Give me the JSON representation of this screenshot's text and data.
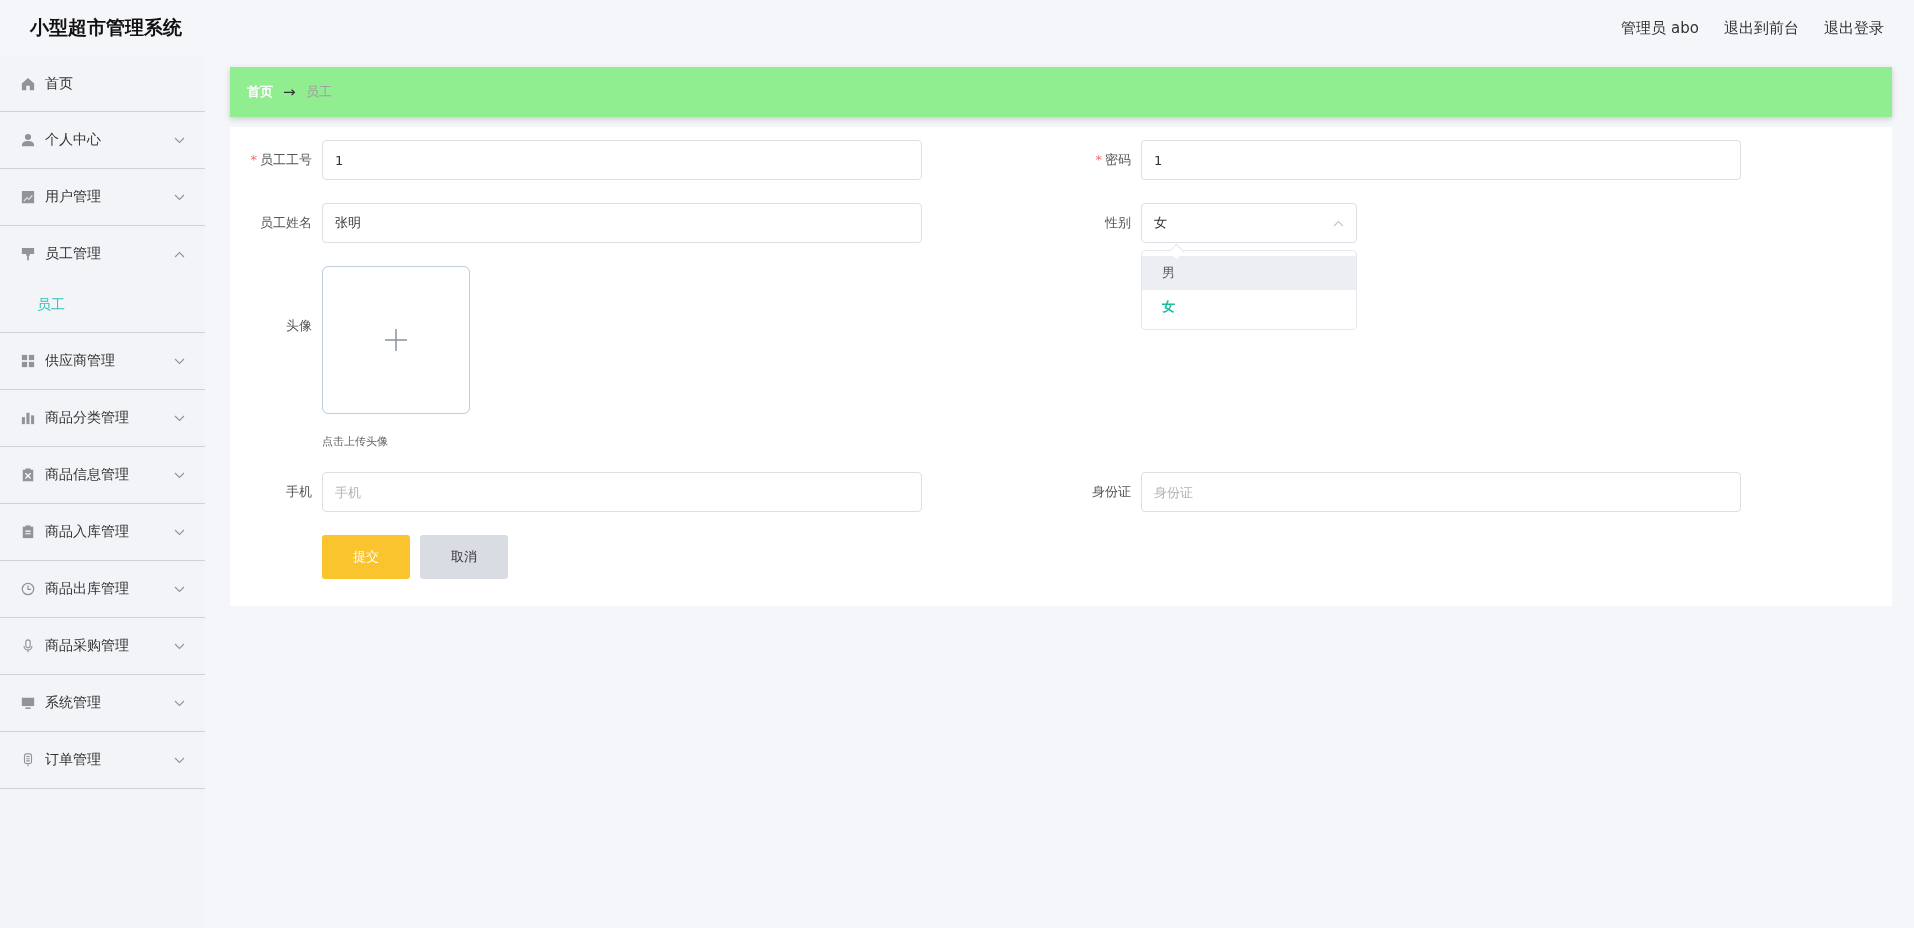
{
  "header": {
    "title": "小型超市管理系统",
    "links": [
      {
        "label": "管理员 abo"
      },
      {
        "label": "退出到前台"
      },
      {
        "label": "退出登录"
      }
    ]
  },
  "sidebar": {
    "items": [
      {
        "label": "首页",
        "kind": "link"
      },
      {
        "label": "个人中心",
        "kind": "group",
        "expanded": false
      },
      {
        "label": "用户管理",
        "kind": "group",
        "expanded": false
      },
      {
        "label": "员工管理",
        "kind": "group",
        "expanded": true,
        "children": [
          {
            "label": "员工",
            "selected": true
          }
        ]
      },
      {
        "label": "供应商管理",
        "kind": "group",
        "expanded": false
      },
      {
        "label": "商品分类管理",
        "kind": "group",
        "expanded": false
      },
      {
        "label": "商品信息管理",
        "kind": "group",
        "expanded": false
      },
      {
        "label": "商品入库管理",
        "kind": "group",
        "expanded": false
      },
      {
        "label": "商品出库管理",
        "kind": "group",
        "expanded": false
      },
      {
        "label": "商品采购管理",
        "kind": "group",
        "expanded": false
      },
      {
        "label": "系统管理",
        "kind": "group",
        "expanded": false
      },
      {
        "label": "订单管理",
        "kind": "group",
        "expanded": false
      }
    ]
  },
  "breadcrumb": {
    "items": [
      {
        "label": "首页"
      },
      {
        "label": "员工"
      }
    ],
    "separator": "→"
  },
  "form": {
    "fields": [
      {
        "kind": "text",
        "label": "员工工号",
        "required_mark": "*",
        "value": "1"
      },
      {
        "kind": "text",
        "label": "密码",
        "required_mark": "*",
        "value": "1"
      },
      {
        "kind": "text",
        "label": "员工姓名",
        "value": "张明"
      },
      {
        "kind": "select",
        "label": "性别",
        "value": "女",
        "expanded": true,
        "options": [
          {
            "label": "男",
            "selected": false,
            "hovered": true
          },
          {
            "label": "女",
            "selected": true,
            "hovered": false
          }
        ]
      },
      {
        "kind": "upload",
        "label": "头像",
        "hint": "点击上传头像"
      },
      {
        "kind": "text",
        "label": "手机",
        "placeholder": "手机"
      },
      {
        "kind": "text",
        "label": "身份证",
        "placeholder": "身份证"
      }
    ],
    "buttons": [
      {
        "kind": "primary",
        "label": "提交"
      },
      {
        "kind": "secondary",
        "label": "取消"
      }
    ]
  }
}
